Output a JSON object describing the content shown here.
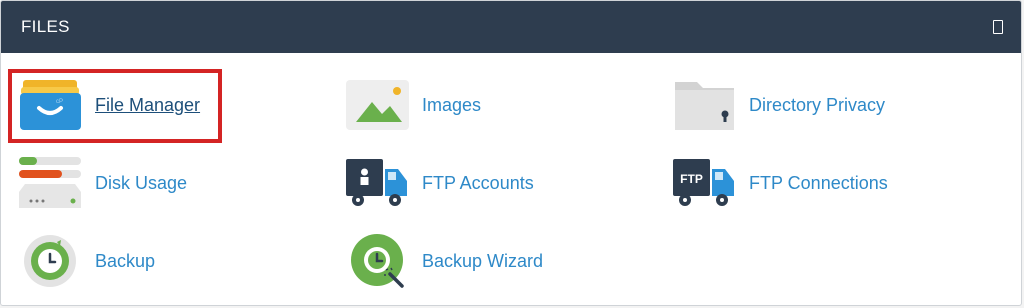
{
  "section": {
    "title": "FILES"
  },
  "items": [
    {
      "id": "file-manager",
      "label": "File Manager",
      "icon": "file-manager-icon",
      "highlighted": true
    },
    {
      "id": "images",
      "label": "Images",
      "icon": "images-icon"
    },
    {
      "id": "directory-privacy",
      "label": "Directory Privacy",
      "icon": "directory-privacy-icon"
    },
    {
      "id": "disk-usage",
      "label": "Disk Usage",
      "icon": "disk-usage-icon"
    },
    {
      "id": "ftp-accounts",
      "label": "FTP Accounts",
      "icon": "ftp-accounts-icon"
    },
    {
      "id": "ftp-connections",
      "label": "FTP Connections",
      "icon": "ftp-connections-icon",
      "icon_text": "FTP"
    },
    {
      "id": "backup",
      "label": "Backup",
      "icon": "backup-icon"
    },
    {
      "id": "backup-wizard",
      "label": "Backup Wizard",
      "icon": "backup-wizard-icon"
    }
  ],
  "colors": {
    "header_bg": "#2e3d4f",
    "link": "#2e89c8",
    "highlight_border": "#d42424"
  }
}
